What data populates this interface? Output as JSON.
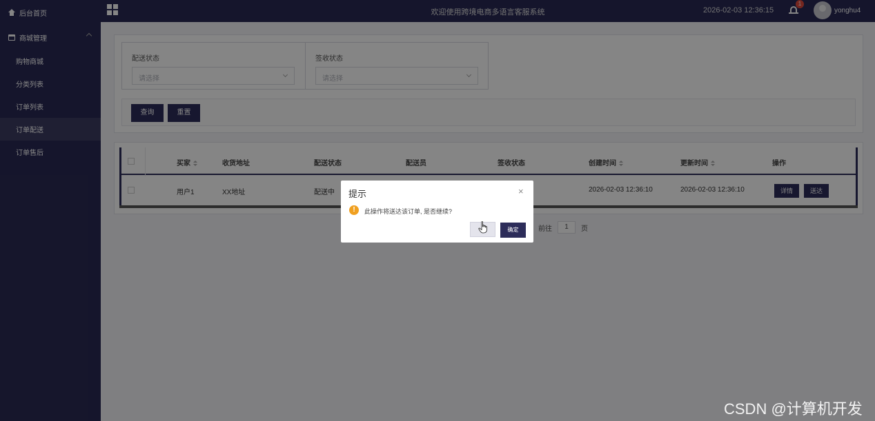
{
  "sidebar": {
    "home": "后台首页",
    "group": "商城管理",
    "items": [
      {
        "label": "购物商城"
      },
      {
        "label": "分类列表"
      },
      {
        "label": "订单列表"
      },
      {
        "label": "订单配送"
      },
      {
        "label": "订单售后"
      }
    ]
  },
  "topbar": {
    "title": "欢迎使用跨境电商多语言客服系统",
    "time": "2026-02-03 12:36:15",
    "badge": "1",
    "username": "yonghu4"
  },
  "filters": {
    "delivery_status_label": "配送状态",
    "delivery_status_placeholder": "请选择",
    "sign_status_label": "签收状态",
    "sign_status_placeholder": "请选择",
    "query_button": "查询",
    "reset_button": "重置"
  },
  "table": {
    "headers": {
      "buyer": "买家",
      "address": "收货地址",
      "delivery_status": "配送状态",
      "courier": "配送员",
      "sign_status": "签收状态",
      "created": "创建时间",
      "updated": "更新时间",
      "actions": "操作"
    },
    "rows": [
      {
        "buyer": "用户1",
        "address": "XX地址",
        "delivery_status": "配送中",
        "created": "2026-02-03 12:36:10",
        "updated": "2026-02-03 12:36:10",
        "detail_button": "详情",
        "deliver_button": "送达"
      }
    ]
  },
  "pager": {
    "goto_label": "前往",
    "page": "1",
    "page_suffix": "页"
  },
  "dialog": {
    "title": "提示",
    "close": "×",
    "message": "此操作将送达该订单, 是否继续?",
    "ok_button": "确定"
  },
  "watermark": "CSDN @计算机开发"
}
